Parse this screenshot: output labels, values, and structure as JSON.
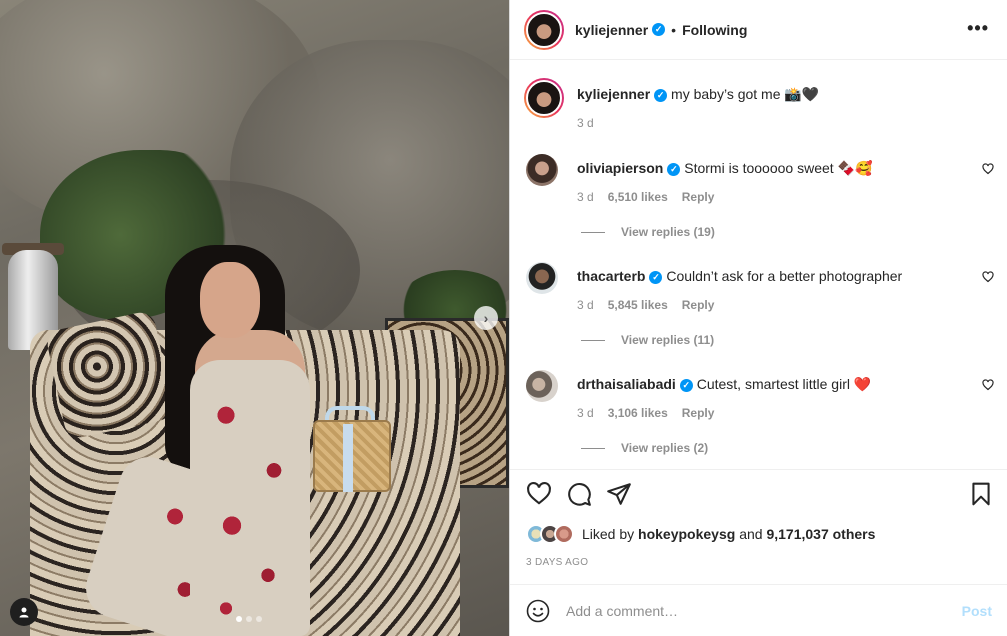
{
  "post": {
    "photo_alt": "",
    "carousel_count": 3,
    "carousel_active": 1
  },
  "header": {
    "username": "kyliejenner",
    "verified_icon": "verified-badge-icon",
    "separator": "•",
    "follow_status": "Following",
    "more_icon": "•••"
  },
  "caption": {
    "username": "kyliejenner",
    "text": "my baby’s got me 📸🖤",
    "age": "3 d"
  },
  "comments": [
    {
      "username": "oliviapierson",
      "text": "Stormi is toooooo sweet 🍫🥰",
      "age": "3 d",
      "likes": "6,510 likes",
      "reply": "Reply",
      "view_replies": "View replies (19)"
    },
    {
      "username": "thacarterb",
      "text": "Couldn’t ask for a better photographer",
      "age": "3 d",
      "likes": "5,845 likes",
      "reply": "Reply",
      "view_replies": "View replies (11)"
    },
    {
      "username": "drthaisaliabadi",
      "text": "Cutest, smartest little girl ❤️",
      "age": "3 d",
      "likes": "3,106 likes",
      "reply": "Reply",
      "view_replies": "View replies (2)"
    }
  ],
  "likes": {
    "prefix": "Liked by",
    "user": "hokeypokeysg",
    "and": "and",
    "others": "9,171,037 others"
  },
  "date": "3 DAYS AGO",
  "add_comment": {
    "placeholder": "Add a comment…",
    "post_label": "Post"
  },
  "colors": {
    "verified": "#0095f6",
    "post_disabled": "#b2dffc",
    "muted": "#8e8e8e",
    "text": "#262626"
  }
}
